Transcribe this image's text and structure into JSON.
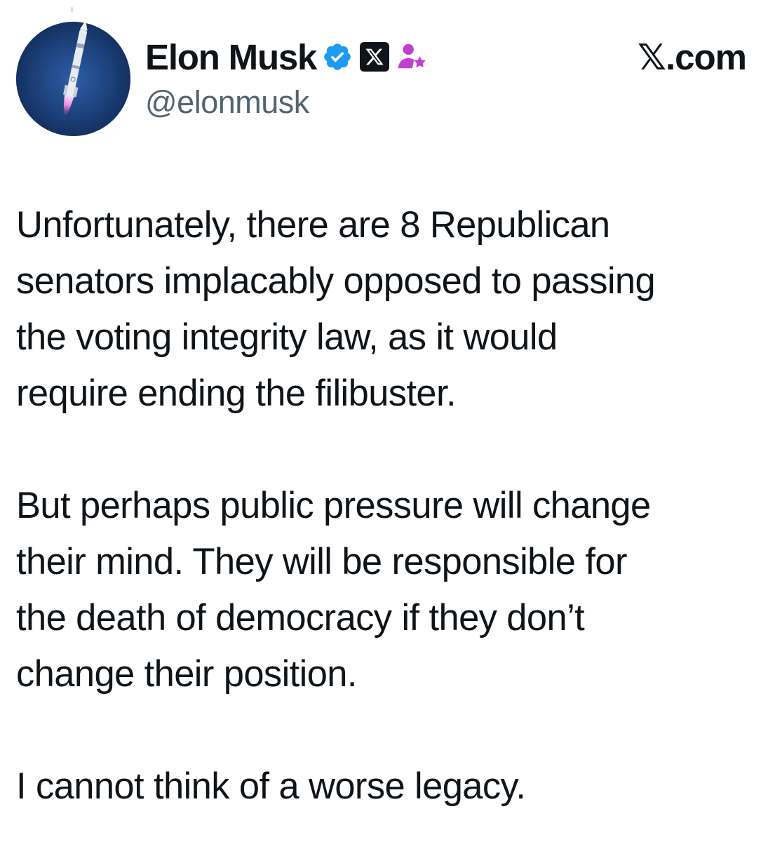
{
  "author": {
    "display_name": "Elon Musk",
    "handle": "@elonmusk",
    "avatar_icon": "rocket-launch-avatar",
    "verified_icon": "verified-badge-icon",
    "affiliation_icon": "x-logo-icon",
    "extra_badge_icon": "affiliate-person-star-icon"
  },
  "header": {
    "brand": "𝕏.com"
  },
  "tweet": {
    "paragraphs": [
      "Unfortunately, there are 8 Republican\nsenators implacably opposed to passing\nthe voting integrity law, as it would\nrequire ending the filibuster.",
      "But perhaps public pressure will change\ntheir mind. They will be responsible for\nthe death of democracy if they don’t\nchange their position.",
      "I cannot think of a worse legacy."
    ]
  },
  "colors": {
    "text_primary": "#0f1419",
    "text_secondary": "#536471",
    "verified_blue": "#1d9bf0",
    "affiliate_purple": "#c03fd1"
  }
}
